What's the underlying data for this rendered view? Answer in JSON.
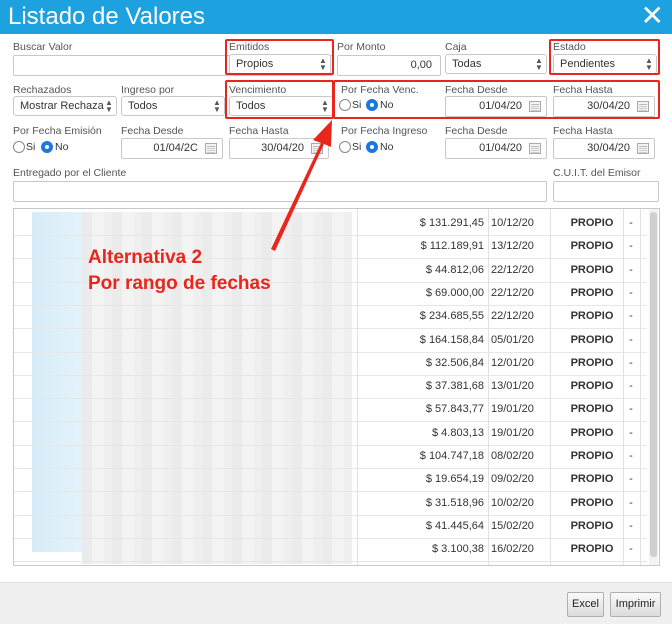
{
  "window": {
    "title": "Listado de Valores",
    "close_icon": "close-icon"
  },
  "filters": {
    "buscar_valor": {
      "label": "Buscar Valor",
      "value": ""
    },
    "emitidos": {
      "label": "Emitidos",
      "value": "Propios"
    },
    "por_monto": {
      "label": "Por Monto",
      "value": "0,00"
    },
    "caja": {
      "label": "Caja",
      "value": "Todas"
    },
    "estado": {
      "label": "Estado",
      "value": "Pendientes"
    },
    "rechazados": {
      "label": "Rechazados",
      "value": "Mostrar Rechaza"
    },
    "ingreso_por": {
      "label": "Ingreso por",
      "value": "Todos"
    },
    "vencimiento": {
      "label": "Vencimiento",
      "value": "Todos"
    },
    "por_fecha_venc": {
      "label": "Por Fecha Venc.",
      "si": "Si",
      "no": "No"
    },
    "fecha_desde_1": {
      "label": "Fecha Desde",
      "value": "01/04/20"
    },
    "fecha_hasta_1": {
      "label": "Fecha Hasta",
      "value": "30/04/20"
    },
    "por_fecha_emision": {
      "label": "Por Fecha Emisión",
      "si": "Si",
      "no": "No"
    },
    "fecha_desde_2": {
      "label": "Fecha Desde",
      "value": "01/04/2C"
    },
    "fecha_hasta_2": {
      "label": "Fecha Hasta",
      "value": "30/04/20"
    },
    "por_fecha_ingreso": {
      "label": "Por Fecha Ingreso",
      "si": "Si",
      "no": "No"
    },
    "fecha_desde_3": {
      "label": "Fecha Desde",
      "value": "01/04/20"
    },
    "fecha_hasta_3": {
      "label": "Fecha Hasta",
      "value": "30/04/20"
    },
    "entregado": {
      "label": "Entregado por el Cliente",
      "value": ""
    },
    "cuit": {
      "label": "C.U.I.T. del Emisor",
      "value": ""
    }
  },
  "table": {
    "rows": [
      {
        "amount": "$ 131.291,45",
        "date": "10/12/20",
        "type": "PROPIO",
        "mark": "-"
      },
      {
        "amount": "$ 112.189,91",
        "date": "13/12/20",
        "type": "PROPIO",
        "mark": "-"
      },
      {
        "amount": "$ 44.812,06",
        "date": "22/12/20",
        "type": "PROPIO",
        "mark": "-"
      },
      {
        "amount": "$ 69.000,00",
        "date": "22/12/20",
        "type": "PROPIO",
        "mark": "-"
      },
      {
        "amount": "$ 234.685,55",
        "date": "22/12/20",
        "type": "PROPIO",
        "mark": "-"
      },
      {
        "amount": "$ 164.158,84",
        "date": "05/01/20",
        "type": "PROPIO",
        "mark": "-"
      },
      {
        "amount": "$ 32.506,84",
        "date": "12/01/20",
        "type": "PROPIO",
        "mark": "-"
      },
      {
        "amount": "$ 37.381,68",
        "date": "13/01/20",
        "type": "PROPIO",
        "mark": "-"
      },
      {
        "amount": "$ 57.843,77",
        "date": "19/01/20",
        "type": "PROPIO",
        "mark": "-"
      },
      {
        "amount": "$ 4.803,13",
        "date": "19/01/20",
        "type": "PROPIO",
        "mark": "-"
      },
      {
        "amount": "$ 104.747,18",
        "date": "08/02/20",
        "type": "PROPIO",
        "mark": "-"
      },
      {
        "amount": "$ 19.654,19",
        "date": "09/02/20",
        "type": "PROPIO",
        "mark": "-"
      },
      {
        "amount": "$ 31.518,96",
        "date": "10/02/20",
        "type": "PROPIO",
        "mark": "-"
      },
      {
        "amount": "$ 41.445,64",
        "date": "15/02/20",
        "type": "PROPIO",
        "mark": "-"
      },
      {
        "amount": "$ 3.100,38",
        "date": "16/02/20",
        "type": "PROPIO",
        "mark": "-"
      }
    ]
  },
  "annotation": {
    "line1": "Alternativa 2",
    "line2": "Por rango de fechas",
    "color": "#e8261b"
  },
  "footer": {
    "excel_label": "Excel",
    "imprimir_label": "Imprimir"
  },
  "colors": {
    "titlebar": "#1da1df",
    "highlight": "#e8261b",
    "radio_on": "#1a78e0"
  }
}
